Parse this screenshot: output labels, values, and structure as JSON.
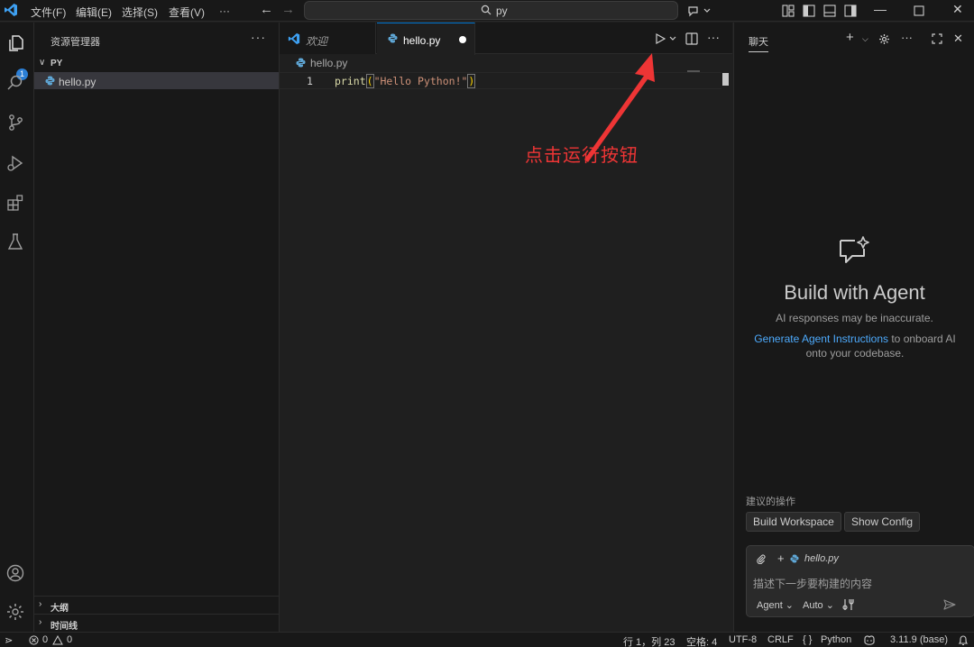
{
  "menu": {
    "file": "文件(F)",
    "edit": "编辑(E)",
    "select": "选择(S)",
    "view": "查看(V)",
    "more": "···"
  },
  "search": {
    "text": "py"
  },
  "sidebar": {
    "title": "资源管理器",
    "more": "···",
    "folder": "PY",
    "files": [
      "hello.py"
    ],
    "outline": "大纲",
    "timeline": "时间线"
  },
  "activity": {
    "badge": "1"
  },
  "tabs": [
    {
      "label": "欢迎"
    },
    {
      "label": "hello.py"
    }
  ],
  "editor": {
    "breadcrumb": "hello.py",
    "line_number": "1",
    "code": {
      "fn": "print",
      "open": "(",
      "str": "\"Hello Python!\"",
      "close": ")"
    },
    "annotation": "点击运行按钮",
    "more": "···"
  },
  "chat": {
    "title": "聊天",
    "hero_title": "Build with Agent",
    "hero_sub": "AI responses may be inaccurate.",
    "hero_link": "Generate Agent Instructions",
    "hero_rest": " to onboard AI onto your codebase.",
    "suggestions_title": "建议的操作",
    "suggestions": [
      "Build Workspace",
      "Show Config"
    ],
    "context_file": "hello.py",
    "placeholder": "描述下一步要构建的内容",
    "mode": "Agent",
    "model": "Auto"
  },
  "status": {
    "errors": "0",
    "warnings": "0",
    "position": "行 1，列 23",
    "indent": "空格: 4",
    "encoding": "UTF-8",
    "eol": "CRLF",
    "language": "Python",
    "braces": "{ }",
    "interpreter": "3.11.9 (base)"
  },
  "colors": {
    "accent": "#0078d4",
    "annotation": "#ee3535",
    "link": "#4daafc"
  }
}
